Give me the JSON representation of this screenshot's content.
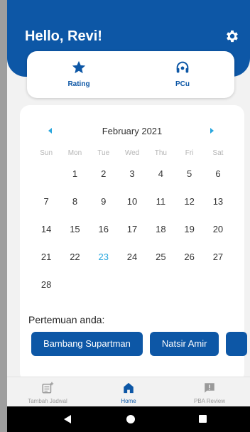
{
  "header": {
    "greeting": "Hello, Revi!",
    "settings_icon": "gear-icon",
    "background_color": "#0d57a6"
  },
  "quick_actions": [
    {
      "label": "Rating",
      "icon": "star-icon"
    },
    {
      "label": "PCu",
      "icon": "headset-icon"
    }
  ],
  "calendar": {
    "month_label": "February 2021",
    "weekdays": [
      "Sun",
      "Mon",
      "Tue",
      "Wed",
      "Thu",
      "Fri",
      "Sat"
    ],
    "days": [
      "",
      "1",
      "2",
      "3",
      "4",
      "5",
      "6",
      "7",
      "8",
      "9",
      "10",
      "11",
      "12",
      "13",
      "14",
      "15",
      "16",
      "17",
      "18",
      "19",
      "20",
      "21",
      "22",
      "23",
      "24",
      "25",
      "26",
      "27",
      "28"
    ],
    "selected_day": "23",
    "accent_color": "#2aa7de"
  },
  "meetings": {
    "title": "Pertemuan anda:",
    "people": [
      "Bambang Supartman",
      "Natsir Amir",
      ""
    ]
  },
  "bottom_nav": [
    {
      "label": "Tambah Jadwal",
      "icon": "add-schedule-icon",
      "active": false
    },
    {
      "label": "Home",
      "icon": "home-icon",
      "active": true
    },
    {
      "label": "PBA Review",
      "icon": "review-icon",
      "active": false
    }
  ]
}
